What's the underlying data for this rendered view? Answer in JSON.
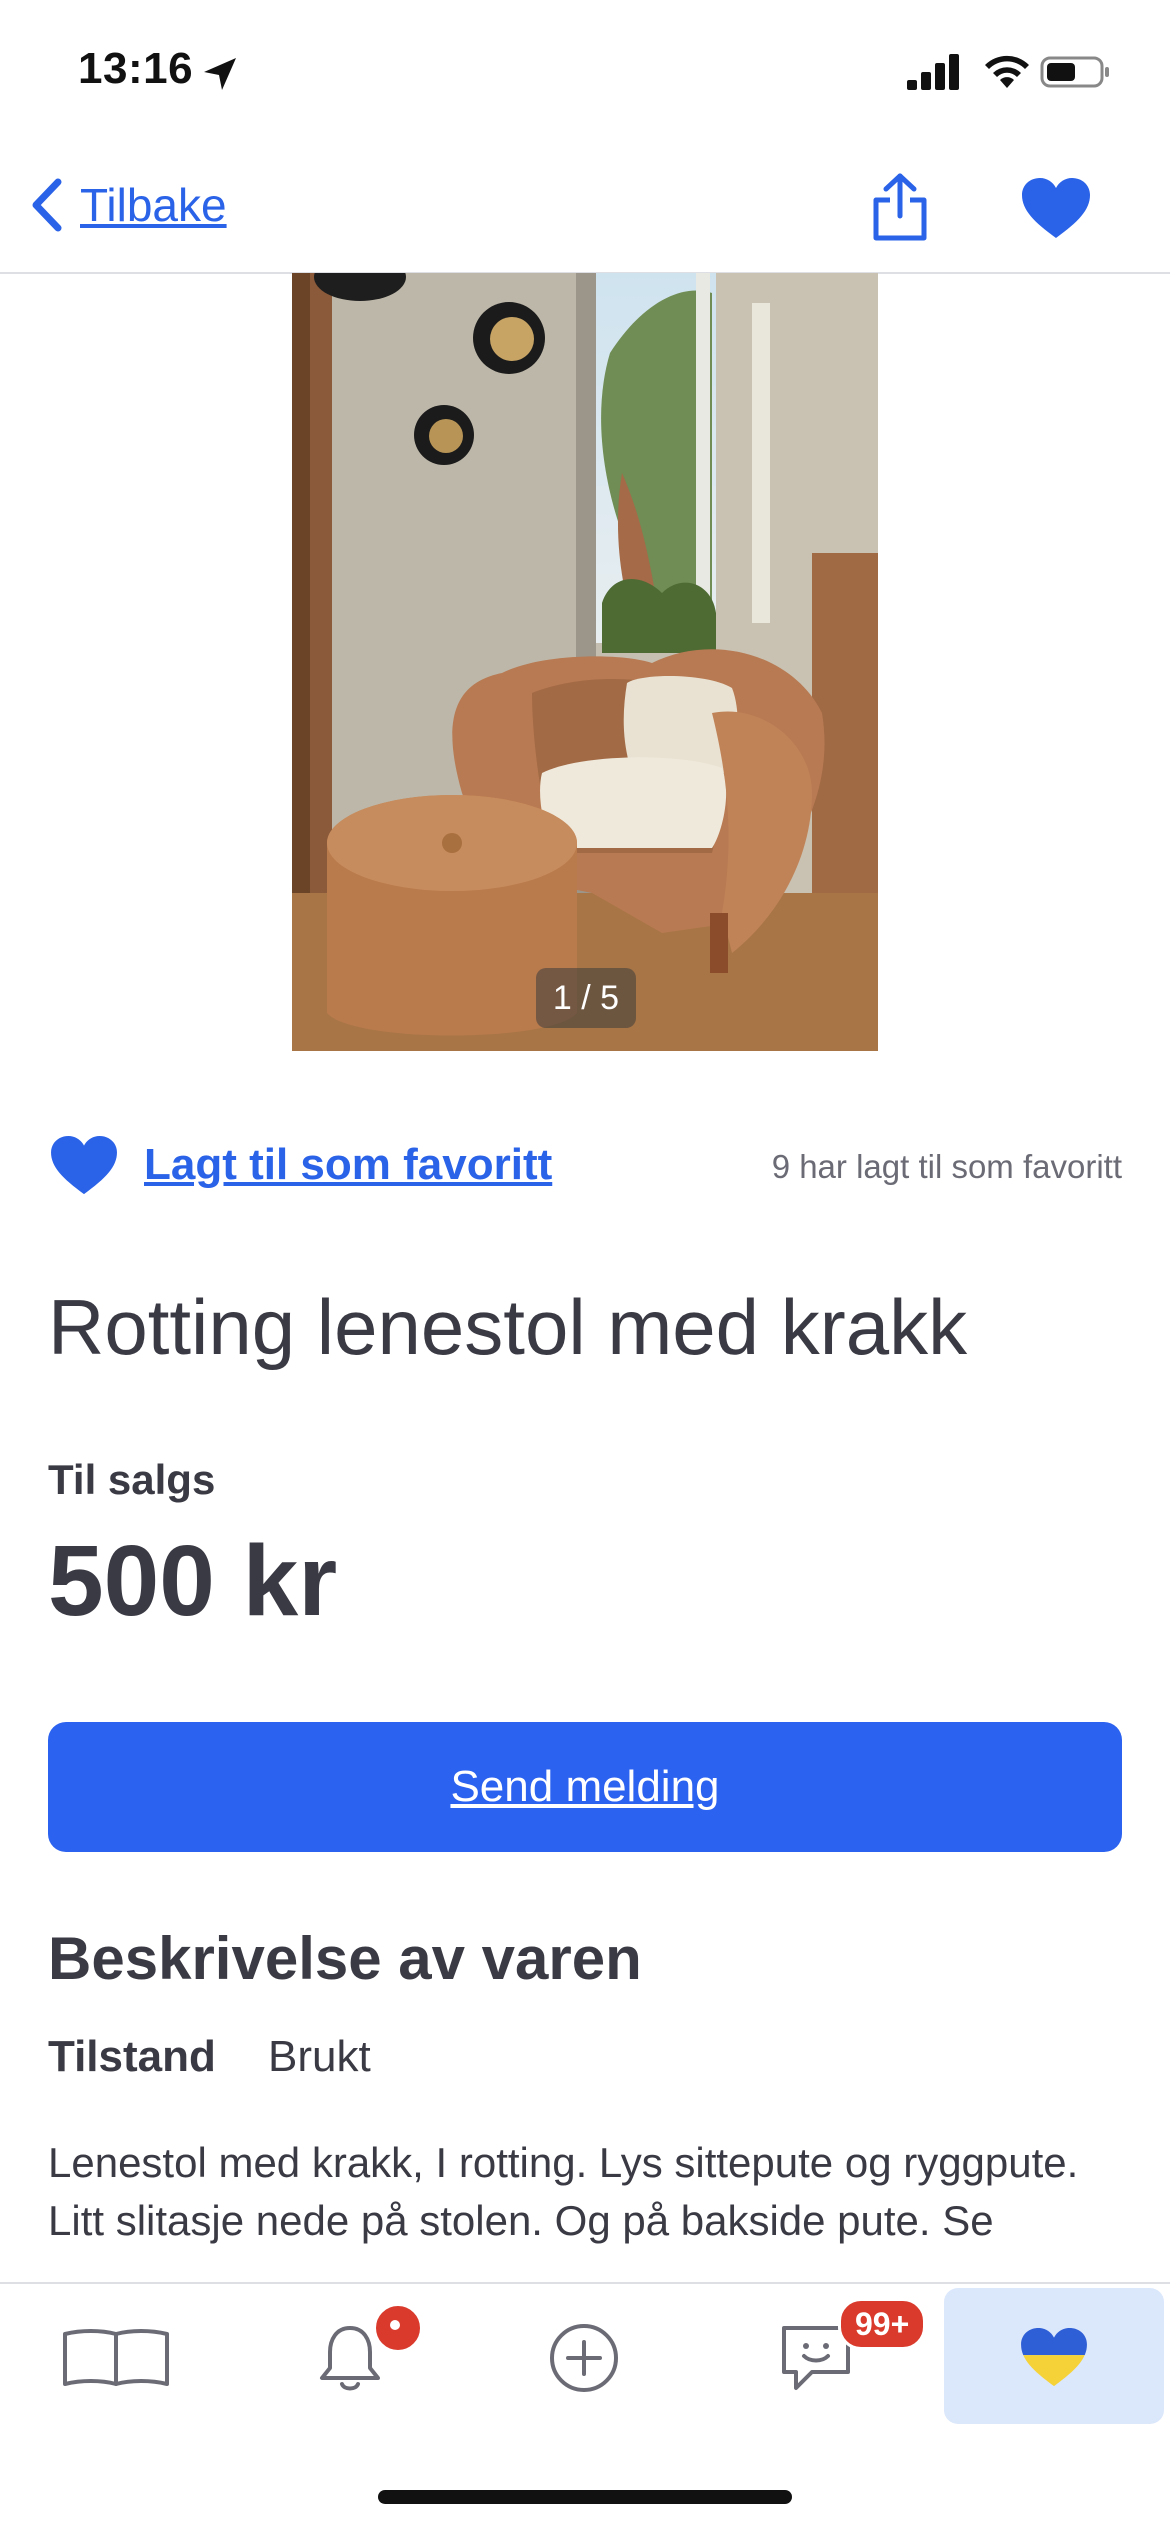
{
  "status_bar": {
    "time": "13:16"
  },
  "nav": {
    "back_label": "Tilbake"
  },
  "gallery": {
    "counter": "1 / 5"
  },
  "favorite": {
    "label": "Lagt til som favoritt",
    "count_text": "9 har lagt til som favoritt"
  },
  "listing": {
    "title": "Rotting lenestol med krakk",
    "status": "Til salgs",
    "price": "500 kr"
  },
  "actions": {
    "send_message": "Send melding"
  },
  "description": {
    "heading": "Beskrivelse av varen",
    "condition_label": "Tilstand",
    "condition_value": "Brukt",
    "body": "Lenestol med krakk, I rotting. Lys sittepute og ryggpute. Litt slitasje nede på stolen. Og på bakside pute. Se"
  },
  "tabbar": {
    "messages_badge": "99+"
  },
  "colors": {
    "accent": "#2b62f0",
    "badge": "#d93a2b",
    "active_tab_bg": "#dbe7fb"
  }
}
